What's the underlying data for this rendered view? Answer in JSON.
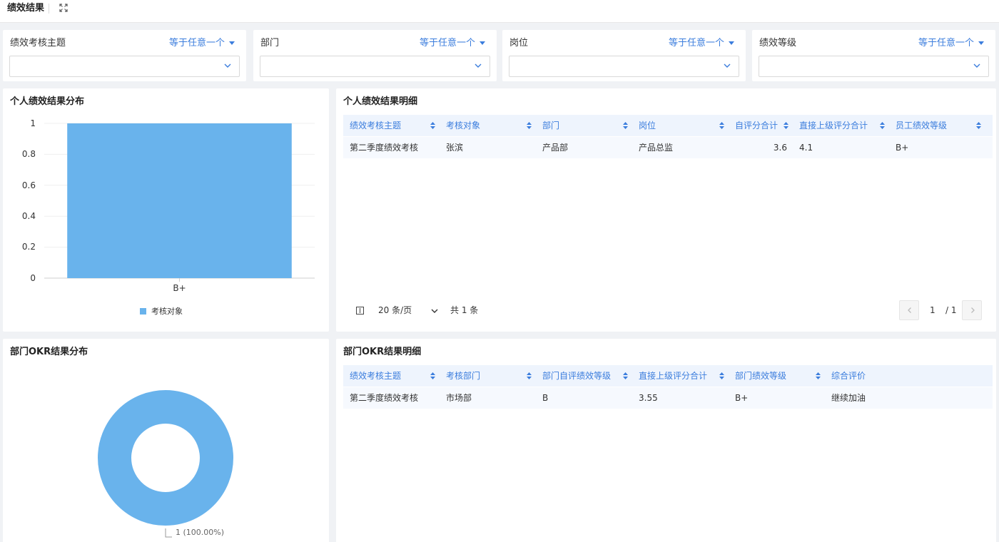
{
  "header": {
    "title": "绩效结果",
    "expand_icon": "expand-icon"
  },
  "filters": [
    {
      "label": "绩效考核主题",
      "operator": "等于任意一个",
      "value": ""
    },
    {
      "label": "部门",
      "operator": "等于任意一个",
      "value": ""
    },
    {
      "label": "岗位",
      "operator": "等于任意一个",
      "value": ""
    },
    {
      "label": "绩效等级",
      "operator": "等于任意一个",
      "value": ""
    }
  ],
  "colors": {
    "accent": "#3b7ddd",
    "series": "#69b3ec",
    "header_bg": "#eef4fd",
    "row_bg": "#f6f9fe"
  },
  "personal_chart": {
    "title": "个人绩效结果分布",
    "legend": "考核对象",
    "y_ticks": [
      "1",
      "0.8",
      "0.6",
      "0.4",
      "0.2",
      "0"
    ]
  },
  "okr_chart": {
    "title": "部门OKR结果分布",
    "slice_label": "1 (100.00%)"
  },
  "chart_data": [
    {
      "type": "bar",
      "title": "个人绩效结果分布",
      "categories": [
        "B+"
      ],
      "series": [
        {
          "name": "考核对象",
          "values": [
            1
          ]
        }
      ],
      "ylim": [
        0,
        1
      ],
      "grid": true,
      "legend_position": "bottom"
    },
    {
      "type": "pie",
      "title": "部门OKR结果分布",
      "labels": [
        "1"
      ],
      "values": [
        1
      ],
      "donut": true
    }
  ],
  "personal_table": {
    "title": "个人绩效结果明细",
    "columns": [
      "绩效考核主题",
      "考核对象",
      "部门",
      "岗位",
      "自评分合计",
      "直接上级评分合计",
      "员工绩效等级"
    ],
    "rows": [
      [
        "第二季度绩效考核",
        "张滨",
        "产品部",
        "产品总监",
        "3.6",
        "4.1",
        "B+"
      ]
    ],
    "pagination": {
      "page_size": "20 条/页",
      "total": "共 1 条",
      "page": "1",
      "pages": "/ 1"
    }
  },
  "okr_table": {
    "title": "部门OKR结果明细",
    "columns": [
      "绩效考核主题",
      "考核部门",
      "部门自评绩效等级",
      "直接上级评分合计",
      "部门绩效等级",
      "综合评价"
    ],
    "rows": [
      [
        "第二季度绩效考核",
        "市场部",
        "B",
        "3.55",
        "B+",
        "继续加油"
      ]
    ]
  }
}
